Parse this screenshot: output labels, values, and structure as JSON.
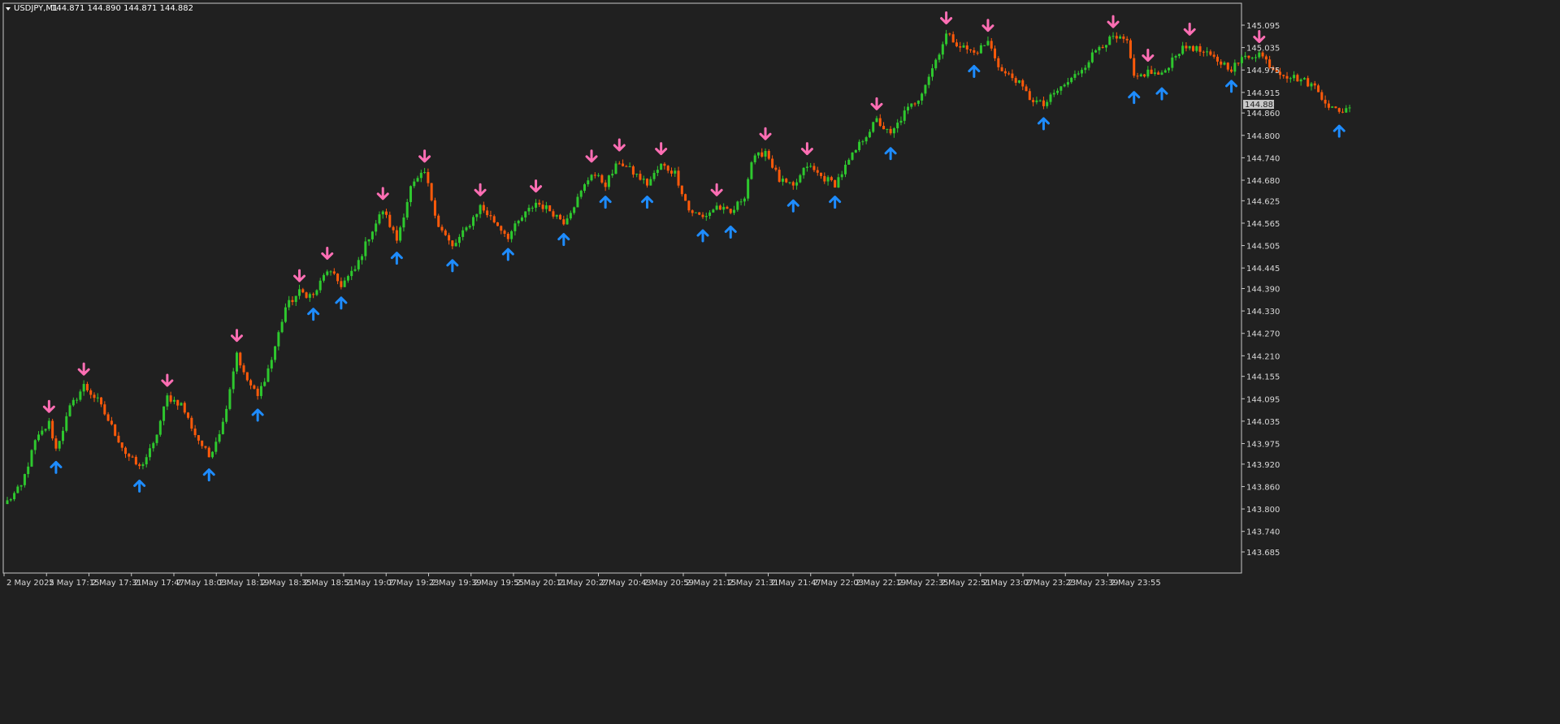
{
  "header": {
    "symbol": "USDJPY,M1",
    "ohlc": "144.871 144.890 144.871 144.882"
  },
  "current_price_label": "144.882",
  "colors": {
    "background": "#202020",
    "frame": "#c8c8c8",
    "bull_candle": "#2ec82e",
    "bear_candle": "#ff5a0a",
    "sell_arrow": "#ff6eb4",
    "buy_arrow": "#1e8cff",
    "price_tag_bg": "#c8c8c8"
  },
  "chart_data": {
    "type": "candlestick",
    "symbol": "USDJPY",
    "timeframe": "M1",
    "y_ticks": [
      "145.095",
      "145.035",
      "144.975",
      "144.915",
      "144.860",
      "144.800",
      "144.740",
      "144.680",
      "144.625",
      "144.565",
      "144.505",
      "144.445",
      "144.390",
      "144.330",
      "144.270",
      "144.210",
      "144.155",
      "144.095",
      "144.035",
      "143.975",
      "143.920",
      "143.860",
      "143.800",
      "143.740",
      "143.685"
    ],
    "x_ticks": [
      "2 May 2025",
      "2 May 17:15",
      "2 May 17:31",
      "2 May 17:47",
      "2 May 18:03",
      "2 May 18:19",
      "2 May 18:35",
      "2 May 18:51",
      "2 May 19:07",
      "2 May 19:23",
      "2 May 19:39",
      "2 May 19:55",
      "2 May 20:11",
      "2 May 20:27",
      "2 May 20:43",
      "2 May 20:59",
      "2 May 21:15",
      "2 May 21:31",
      "2 May 21:47",
      "2 May 22:03",
      "2 May 22:19",
      "2 May 22:35",
      "2 May 22:51",
      "2 May 23:07",
      "2 May 23:23",
      "2 May 23:39",
      "2 May 23:55"
    ],
    "ylim": [
      143.685,
      145.095
    ],
    "last_price": 144.882,
    "approx_close_path": [
      [
        0,
        143.82
      ],
      [
        4,
        143.86
      ],
      [
        8,
        143.98
      ],
      [
        12,
        144.03
      ],
      [
        14,
        143.96
      ],
      [
        18,
        144.07
      ],
      [
        22,
        144.13
      ],
      [
        26,
        144.09
      ],
      [
        30,
        144.02
      ],
      [
        34,
        143.95
      ],
      [
        38,
        143.91
      ],
      [
        42,
        143.97
      ],
      [
        46,
        144.1
      ],
      [
        50,
        144.08
      ],
      [
        54,
        144.0
      ],
      [
        58,
        143.94
      ],
      [
        62,
        144.03
      ],
      [
        66,
        144.22
      ],
      [
        68,
        144.16
      ],
      [
        72,
        144.1
      ],
      [
        76,
        144.2
      ],
      [
        80,
        144.34
      ],
      [
        84,
        144.38
      ],
      [
        88,
        144.37
      ],
      [
        92,
        144.44
      ],
      [
        96,
        144.4
      ],
      [
        100,
        144.44
      ],
      [
        104,
        144.53
      ],
      [
        108,
        144.6
      ],
      [
        112,
        144.52
      ],
      [
        116,
        144.66
      ],
      [
        120,
        144.7
      ],
      [
        124,
        144.56
      ],
      [
        128,
        144.5
      ],
      [
        132,
        144.55
      ],
      [
        136,
        144.61
      ],
      [
        140,
        144.57
      ],
      [
        144,
        144.53
      ],
      [
        148,
        144.58
      ],
      [
        152,
        144.62
      ],
      [
        156,
        144.6
      ],
      [
        160,
        144.57
      ],
      [
        164,
        144.63
      ],
      [
        168,
        144.7
      ],
      [
        172,
        144.67
      ],
      [
        176,
        144.73
      ],
      [
        180,
        144.7
      ],
      [
        184,
        144.67
      ],
      [
        188,
        144.72
      ],
      [
        192,
        144.7
      ],
      [
        196,
        144.6
      ],
      [
        200,
        144.58
      ],
      [
        204,
        144.61
      ],
      [
        208,
        144.59
      ],
      [
        212,
        144.64
      ],
      [
        214,
        144.73
      ],
      [
        218,
        144.76
      ],
      [
        222,
        144.68
      ],
      [
        226,
        144.66
      ],
      [
        230,
        144.72
      ],
      [
        234,
        144.69
      ],
      [
        238,
        144.67
      ],
      [
        242,
        144.73
      ],
      [
        246,
        144.79
      ],
      [
        250,
        144.84
      ],
      [
        254,
        144.8
      ],
      [
        258,
        144.86
      ],
      [
        262,
        144.9
      ],
      [
        266,
        144.98
      ],
      [
        270,
        145.07
      ],
      [
        274,
        145.04
      ],
      [
        278,
        145.02
      ],
      [
        282,
        145.05
      ],
      [
        286,
        144.97
      ],
      [
        290,
        144.95
      ],
      [
        294,
        144.9
      ],
      [
        298,
        144.88
      ],
      [
        302,
        144.92
      ],
      [
        306,
        144.95
      ],
      [
        310,
        144.99
      ],
      [
        314,
        145.04
      ],
      [
        318,
        145.06
      ],
      [
        322,
        145.05
      ],
      [
        324,
        144.95
      ],
      [
        328,
        144.97
      ],
      [
        332,
        144.96
      ],
      [
        336,
        145.02
      ],
      [
        340,
        145.04
      ],
      [
        344,
        145.02
      ],
      [
        348,
        145.0
      ],
      [
        352,
        144.98
      ],
      [
        356,
        145.01
      ],
      [
        360,
        145.02
      ],
      [
        364,
        144.98
      ],
      [
        368,
        144.96
      ],
      [
        372,
        144.95
      ],
      [
        376,
        144.93
      ],
      [
        380,
        144.88
      ],
      [
        383,
        144.86
      ],
      [
        386,
        144.88
      ]
    ]
  }
}
